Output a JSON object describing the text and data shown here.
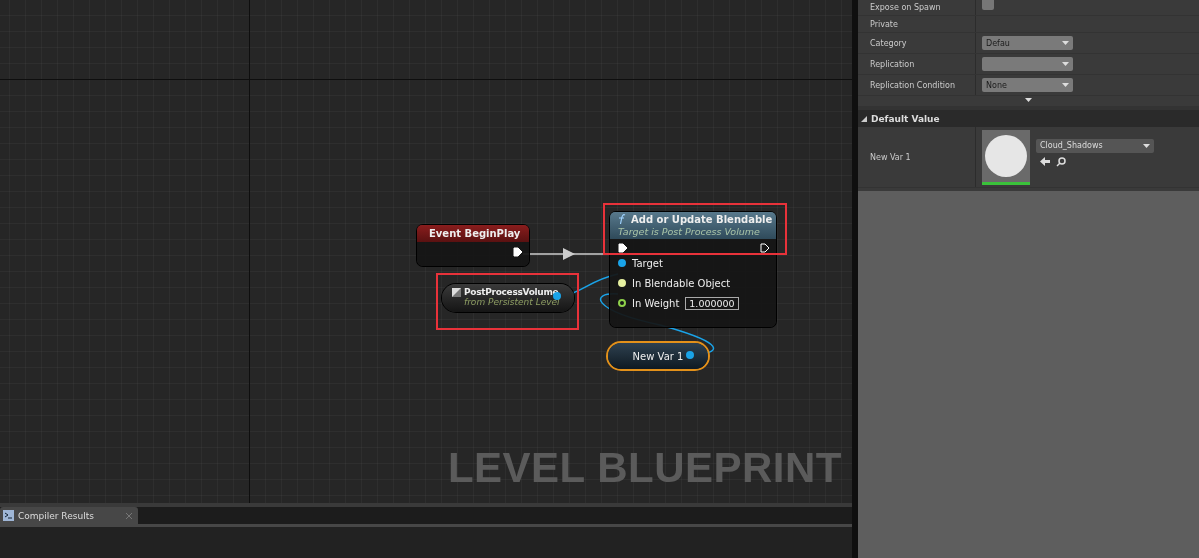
{
  "graph": {
    "corner_label": "LEVEL BLUEPRINT",
    "nodes": [
      {
        "kind": "event",
        "title": "Event BeginPlay",
        "selected": false,
        "highlighted": false
      },
      {
        "kind": "reference",
        "title": "PostProcessVolume",
        "subtitle": "from Persistent Level",
        "selected": false,
        "highlighted": true
      },
      {
        "kind": "function",
        "title": "Add or Update Blendable",
        "subtitle": "Target is Post Process Volume",
        "selected": false,
        "highlighted": true,
        "pins": [
          {
            "label": "Target",
            "color": "#1aa3e8",
            "connected": true
          },
          {
            "label": "In Blendable Object",
            "color": "#e6f0a0",
            "connected": true
          },
          {
            "label": "In Weight",
            "color": "#8ed04a",
            "connected": false,
            "value": "1.000000"
          }
        ]
      },
      {
        "kind": "variable",
        "title": "New Var 1",
        "selected": true,
        "highlighted": false
      }
    ]
  },
  "details": {
    "rows": [
      {
        "label": "Expose on Spawn",
        "kind": "checkbox",
        "checked": false
      },
      {
        "label": "Private",
        "kind": "plain"
      },
      {
        "label": "Category",
        "kind": "combo",
        "value": "Defau"
      },
      {
        "label": "Replication",
        "kind": "dropdown"
      },
      {
        "label": "Replication Condition",
        "kind": "dropdown",
        "value": "None"
      }
    ],
    "default_value": {
      "title": "Default Value",
      "expanded": true,
      "rows": [
        {
          "label": "New Var 1",
          "asset": "Cloud_Shadows"
        }
      ]
    }
  },
  "bottom_tabs": [
    {
      "label": "Compiler Results",
      "selected": true
    }
  ]
}
